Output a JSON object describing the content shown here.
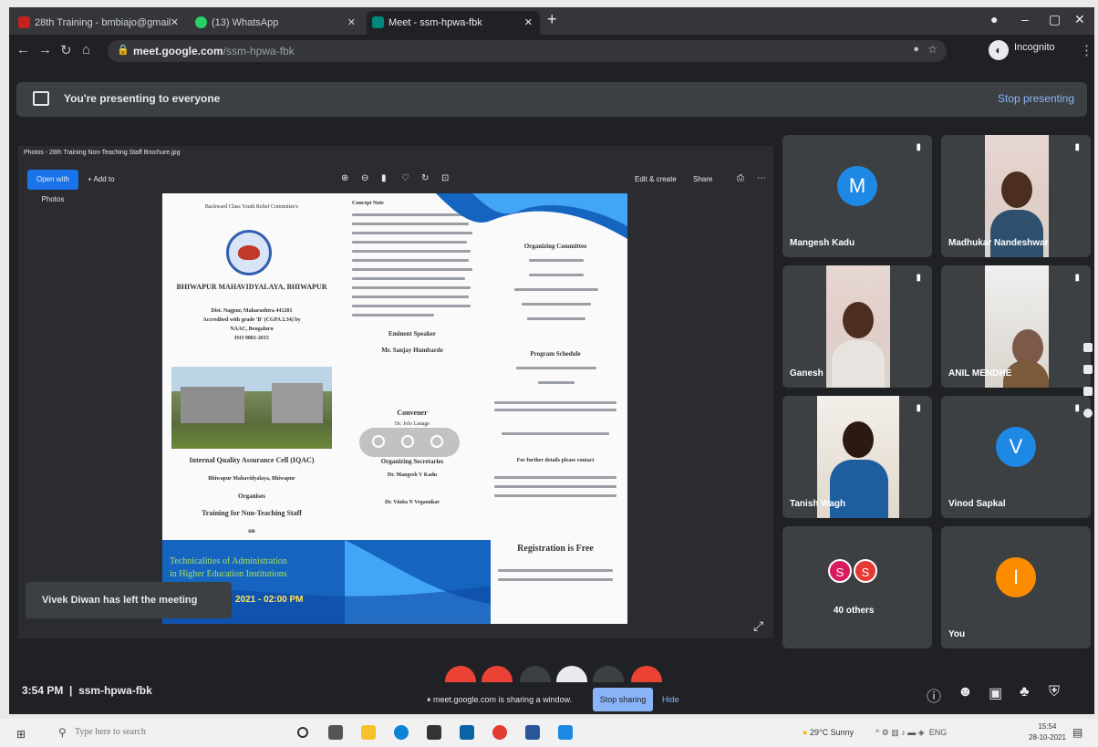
{
  "browser": {
    "tabs": [
      {
        "label": "28th Training - bmbiajo@gmail ·",
        "color": "#c5221f"
      },
      {
        "label": "(13) WhatsApp",
        "color": "#25d366"
      },
      {
        "label": "Meet - ssm-hpwa-fbk",
        "color": "#00897b"
      }
    ],
    "url_host": "meet.google.com",
    "url_path": "/ssm-hpwa-fbk",
    "profile": "Incognito"
  },
  "banner": {
    "text": "You're presenting to everyone",
    "stop_label": "Stop presenting"
  },
  "stage": {
    "title": "Photos - 28th Training Non-Teaching Staff Brochure.jpg",
    "open_label": "Open with Photos",
    "add_label": "+ Add to",
    "edit_label": "Edit & create",
    "share_label": "Share"
  },
  "brochure": {
    "committee": "Backward Class Youth Relief Committee's",
    "college": "BHIWAPUR MAHAVIDYALAYA, BHIWAPUR",
    "address1": "Dist. Nagpur, Maharashtra 441201",
    "address2": "Accredited with grade 'B' (CGPA 2.34) by",
    "address3": "NAAC, Bengaluru",
    "address4": "ISO 9001-2015",
    "iqac": "Internal Quality Assurance Cell (IQAC)",
    "iqac2": "Bhiwapur Mahavidyalaya, Bhiwapur",
    "organises": "Organises",
    "training": "Training for Non-Teaching Staff",
    "on": "on",
    "concept": "Concept Note",
    "eminent": "Eminent Speaker",
    "speaker": "Mr. Sanjay Humbarde",
    "convener": "Convener",
    "convener_name": "Dr. Jolo Lanage",
    "org_sec": "Organizing Secretaries",
    "sec1": "Dr. Mangesh V Kadu",
    "sec2": "Dr. Vinita N Vegaonkar",
    "org_committee": "Organizing Committee",
    "schedule": "Program Schedule",
    "details": "For further details please contact",
    "registration": "Registration is Free",
    "theme1": "Technicalities of Administration",
    "theme2": "in Higher Education Institutions",
    "date": "2021 - 02:00 PM"
  },
  "toast": "Vivek Diwan has left the meeting",
  "participants": [
    {
      "name": "Mangesh Kadu",
      "initial": "M",
      "color": "#1e88e5"
    },
    {
      "name": "Madhukar Nandeshwar"
    },
    {
      "name": "Ganesh"
    },
    {
      "name": "ANIL MENDHE"
    },
    {
      "name": "Tanish Wagh"
    },
    {
      "name": "Vinod Sapkal",
      "initial": "V",
      "color": "#1e88e5"
    },
    {
      "name": "40 others",
      "initial1": "S",
      "initial2": "S",
      "color1": "#d81b60",
      "color2": "#e53935"
    },
    {
      "name": "You",
      "initial": "I",
      "color": "#fb8c00"
    }
  ],
  "bottom": {
    "time": "3:54 PM",
    "meeting_code": "ssm-hpwa-fbk",
    "sharing_text": "meet.google.com is sharing a window.",
    "stop_sharing": "Stop sharing",
    "hide": "Hide"
  },
  "taskbar": {
    "search_placeholder": "Type here to search",
    "weather": "29°C  Sunny",
    "lang": "ENG",
    "time": "15:54",
    "date": "28-10-2021"
  }
}
